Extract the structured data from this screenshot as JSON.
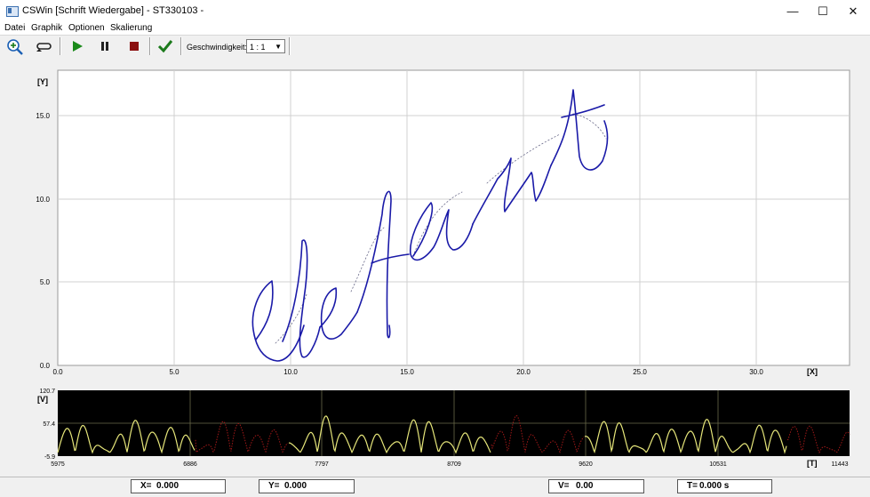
{
  "window": {
    "title": "CSWin [Schrift Wiedergabe] - ST330103 -",
    "minimize": "—",
    "maximize": "☐",
    "close": "✕"
  },
  "menu": {
    "items": [
      "Datei",
      "Graphik",
      "Optionen",
      "Skalierung"
    ]
  },
  "toolbar": {
    "icons": [
      "zoom-in-icon",
      "loop-icon",
      "play-icon",
      "pause-icon",
      "stop-icon",
      "check-icon"
    ],
    "colors": {
      "play": "#1a8a1a",
      "stop": "#8b1010",
      "check": "#1b7a1b"
    },
    "speed_label": "Geschwindigkeit:",
    "speed_value": "1 : 1"
  },
  "main_plot": {
    "y_axis_label": "[Y]",
    "x_axis_label": "[X]",
    "x_ticks": [
      "0.0",
      "5.0",
      "10.0",
      "15.0",
      "20.0",
      "25.0",
      "30.0"
    ],
    "y_ticks": [
      "0.0",
      "5.0",
      "10.0",
      "15.0"
    ],
    "ink_color": "#1a1aa8",
    "background": "#ffffff"
  },
  "velocity_plot": {
    "y_axis_label": "[V]",
    "x_axis_label": "[T]",
    "y_ticks": [
      "-5.9",
      "57.4",
      "120.7"
    ],
    "x_ticks": [
      "5975",
      "6886",
      "7797",
      "8709",
      "9620",
      "10531",
      "11443"
    ],
    "background": "#000000",
    "pen_down_color": "#e6e67a",
    "pen_up_color": "#a01818"
  },
  "status": {
    "x_label": "X=",
    "x_value": "0.000",
    "y_label": "Y=",
    "y_value": "0.000",
    "v_label": "V=",
    "v_value": "0.00",
    "t_label": "T=",
    "t_value": "0.000 s"
  }
}
